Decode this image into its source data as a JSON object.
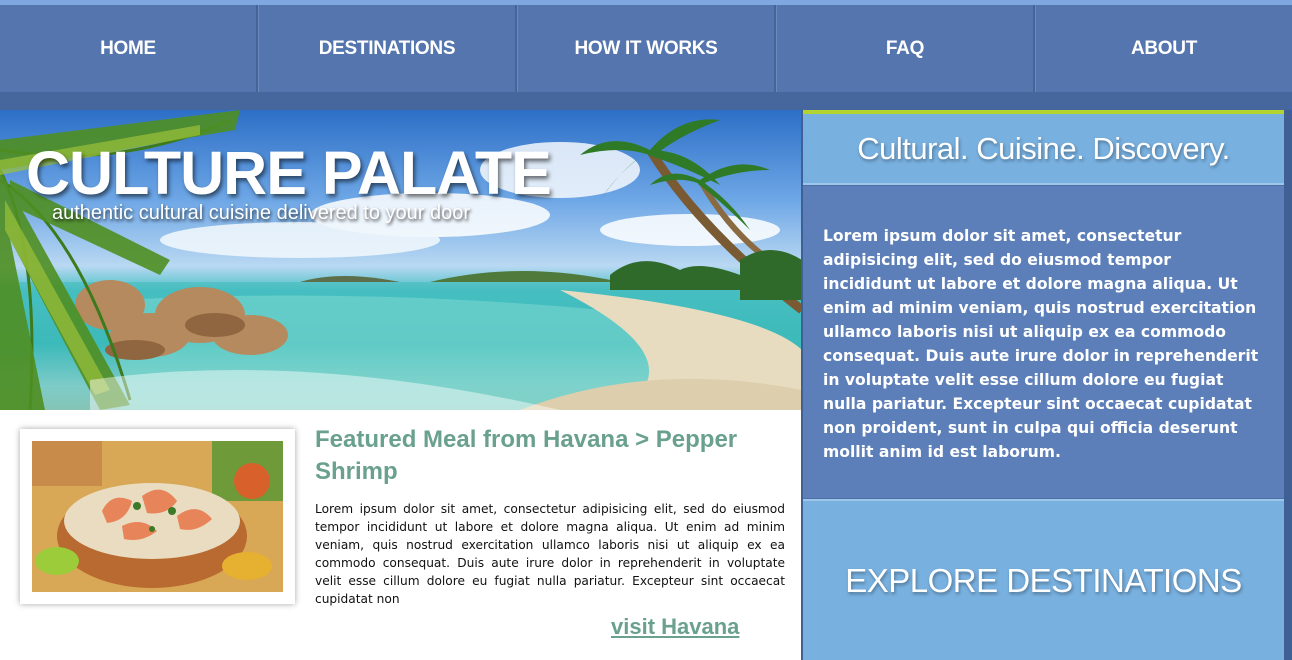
{
  "nav": {
    "items": [
      "HOME",
      "DESTINATIONS",
      "HOW IT WORKS",
      "FAQ",
      "ABOUT"
    ]
  },
  "hero": {
    "title": "CULTURE PALATE",
    "subtitle": "authentic cultural cuisine delivered to your door"
  },
  "feature": {
    "title": "Featured Meal from Havana > Pepper Shrimp",
    "body": "Lorem ipsum dolor sit amet, consectetur adipisicing elit, sed do eiusmod tempor incididunt ut labore et dolore magna aliqua. Ut enim ad minim veniam, quis nostrud exercitation ullamco laboris nisi ut aliquip ex ea commodo consequat. Duis aute irure dolor in reprehenderit in voluptate velit esse cillum dolore eu fugiat nulla pariatur. Excepteur sint occaecat cupidatat non",
    "link": "visit Havana"
  },
  "sidebar": {
    "tagline": "Cultural. Cuisine. Discovery.",
    "body": "Lorem ipsum dolor sit amet, consectetur adipisicing elit, sed do eiusmod tempor incididunt ut labore et dolore magna aliqua. Ut enim ad minim veniam, quis nostrud exercitation ullamco laboris nisi ut aliquip ex ea commodo consequat. Duis aute irure dolor in reprehenderit in voluptate velit esse cillum dolore eu fugiat nulla pariatur. Excepteur sint occaecat cupidatat non proident, sunt in culpa qui officia deserunt mollit anim id est laborum.",
    "explore": "EXPLORE DESTINATIONS"
  },
  "colors": {
    "nav_bg": "#5475ad",
    "accent_green": "#6aa08e",
    "sidebar_light": "#78b0df",
    "sidebar_dark": "#5d7fb9",
    "lime_accent": "#b3d330"
  }
}
